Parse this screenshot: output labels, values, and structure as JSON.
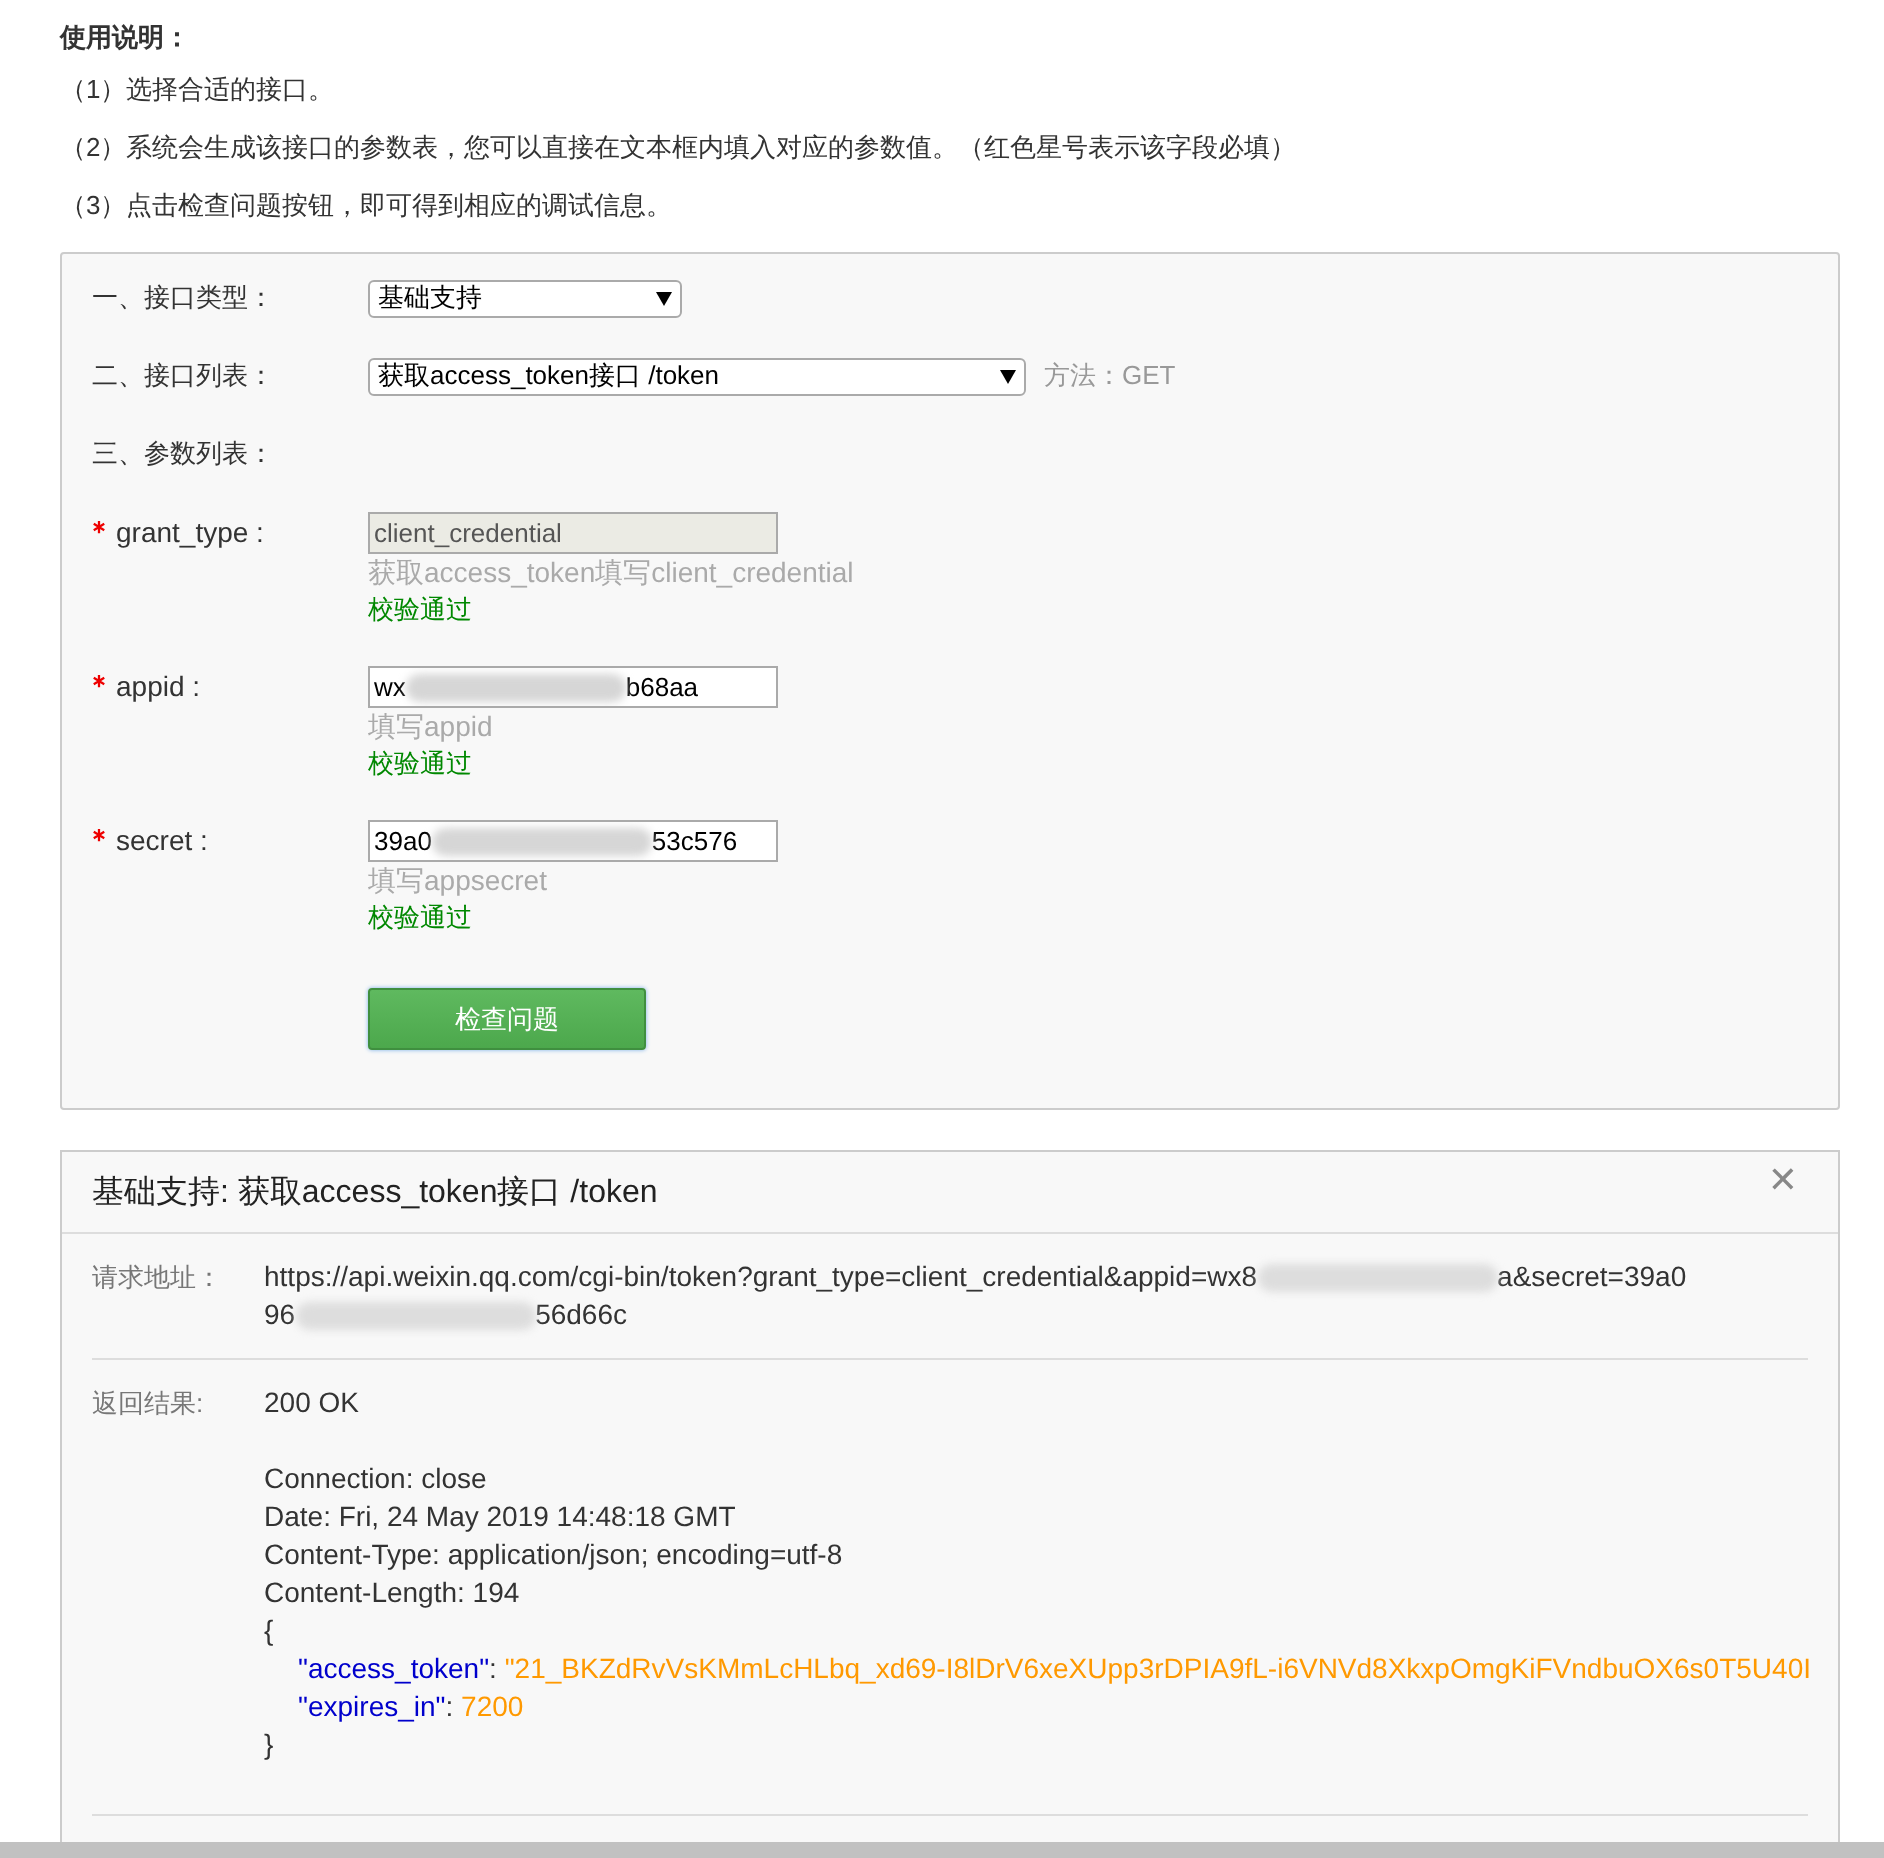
{
  "usage": {
    "title": "使用说明：",
    "steps": [
      "（1）选择合适的接口。",
      "（2）系统会生成该接口的参数表，您可以直接在文本框内填入对应的参数值。（红色星号表示该字段必填）",
      "（3）点击检查问题按钮，即可得到相应的调试信息。"
    ]
  },
  "form": {
    "rows": [
      {
        "label": "一、接口类型：",
        "select": "基础支持"
      },
      {
        "label": "二、接口列表：",
        "select": "获取access_token接口 /token",
        "method": "方法：GET"
      },
      {
        "label": "三、参数列表："
      }
    ],
    "params": [
      {
        "required": true,
        "name": "grant_type :",
        "value_parts": [
          "client_credential"
        ],
        "disabled": true,
        "hint": "获取access_token填写client_credential",
        "status": "校验通过"
      },
      {
        "required": true,
        "name": "appid :",
        "value_parts": [
          "wx",
          "b68aa"
        ],
        "disabled": false,
        "hint": "填写appid",
        "status": "校验通过"
      },
      {
        "required": true,
        "name": "secret :",
        "value_parts": [
          "39a0",
          "53c576"
        ],
        "disabled": false,
        "hint": "填写appsecret",
        "status": "校验通过"
      }
    ],
    "submit": "检查问题"
  },
  "result": {
    "title": "基础支持: 获取access_token接口 /token",
    "close": "✕",
    "request_label": "请求地址：",
    "request_lines": [
      [
        "https://api.weixin.qq.com/cgi-bin/token?grant_type=client_credential&appid=wx8",
        "a&secret=39a0"
      ],
      [
        "96",
        "56d66c"
      ]
    ],
    "response_label": "返回结果:",
    "status_line": "200 OK",
    "headers": [
      "Connection: close",
      "Date: Fri, 24 May 2019 14:48:18 GMT",
      "Content-Type: application/json; encoding=utf-8",
      "Content-Length: 194"
    ],
    "json_open": "{",
    "json_fields": [
      {
        "key": "\"access_token\"",
        "sep": ": ",
        "value": "\"21_BKZdRvVsKMmLcHLbq_xd69-I8lDrV6xeXUpp3rDPIA9fL-i6VNVd8XkxpOmgKiFVndbuOX6s0T5U40I"
      },
      {
        "key": "\"expires_in\"",
        "sep": ": ",
        "value": "7200"
      }
    ],
    "json_close": "}"
  }
}
